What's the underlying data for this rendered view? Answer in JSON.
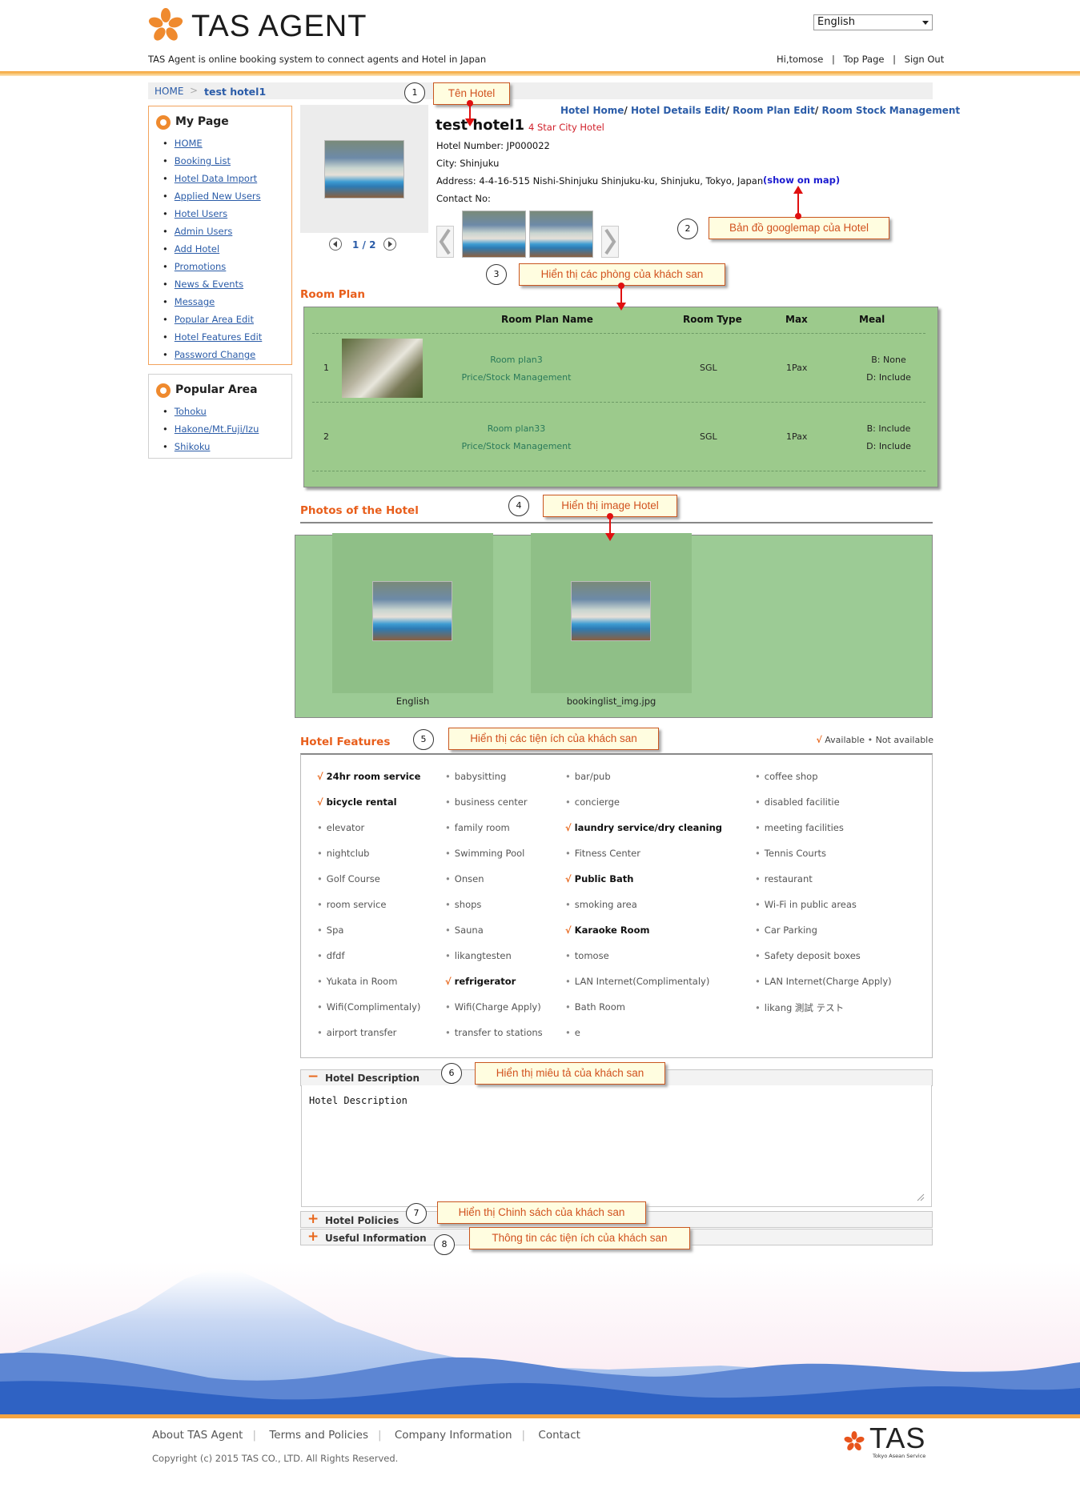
{
  "header": {
    "logo_text": "TAS AGENT",
    "tagline": "TAS Agent is online booking system to connect agents and Hotel in Japan",
    "language": "English",
    "greeting": "Hi,tomose",
    "top_page": "Top Page",
    "sign_out": "Sign Out",
    "sep": "|"
  },
  "breadcrumb": {
    "home": "HOME",
    "sep": ">",
    "current": "test hotel1"
  },
  "mypage": {
    "title": "My Page",
    "items": [
      "HOME",
      "Booking List",
      "Hotel Data Import",
      "Applied New Users",
      "Hotel Users",
      "Admin Users",
      "Add Hotel",
      "Promotions",
      "News & Events",
      "Message",
      "Popular Area Edit",
      "Hotel Features Edit",
      "Password Change"
    ]
  },
  "popular": {
    "title": "Popular Area",
    "items": [
      "Tohoku",
      "Hakone/Mt.Fuji/Izu",
      "Shikoku"
    ]
  },
  "top_links": {
    "hotel_home": "Hotel Home",
    "sep": "/",
    "details_edit": "Hotel Details Edit",
    "room_plan_edit": "Room Plan Edit",
    "room_stock": "Room Stock Management"
  },
  "hotel": {
    "name": "test hotel1",
    "stars": "4 Star City Hotel",
    "number": "Hotel Number: JP000022",
    "city": "City: Shinjuku",
    "address": "Address: 4-4-16-515 Nishi-Shinjuku Shinjuku-ku, Shinjuku, Tokyo, Japan",
    "map_link": "(show on map)",
    "contact": "Contact No:",
    "pager": "1 / 2"
  },
  "annotations": [
    {
      "num": "1",
      "text": "Tên Hotel"
    },
    {
      "num": "2",
      "text": "Bản đồ googlemap của Hotel"
    },
    {
      "num": "3",
      "text": "Hiển thị các phòng của khách san"
    },
    {
      "num": "4",
      "text": "Hiển thị image Hotel"
    },
    {
      "num": "5",
      "text": "Hiển thị các tiện ích của khách san"
    },
    {
      "num": "6",
      "text": "Hiển thị miêu tả của khách san"
    },
    {
      "num": "7",
      "text": "Hiển thị Chinh sách của khách san"
    },
    {
      "num": "8",
      "text": "Thông tin các tiện ích của khách san"
    }
  ],
  "room_plan": {
    "title": "Room Plan",
    "headers": {
      "name": "Room Plan Name",
      "type": "Room Type",
      "max": "Max",
      "meal": "Meal"
    },
    "rows": [
      {
        "no": "1",
        "name": "Room plan3",
        "link": "Price/Stock Management",
        "type": "SGL",
        "max": "1Pax",
        "meal1": "B: None",
        "meal2": "D: Include"
      },
      {
        "no": "2",
        "name": "Room plan33",
        "link": "Price/Stock Management",
        "type": "SGL",
        "max": "1Pax",
        "meal1": "B: Include",
        "meal2": "D: Include"
      }
    ]
  },
  "photos": {
    "title": "Photos of the Hotel",
    "items": [
      "English",
      "bookinglist_img.jpg"
    ]
  },
  "features": {
    "title": "Hotel Features",
    "legend_available": "Available",
    "legend_not": "Not available",
    "check": "√",
    "bullet": "•",
    "rows": [
      [
        [
          "24hr room service",
          true
        ],
        [
          "babysitting",
          false
        ],
        [
          "bar/pub",
          false
        ],
        [
          "coffee shop",
          false
        ]
      ],
      [
        [
          "bicycle rental",
          true
        ],
        [
          "business center",
          false
        ],
        [
          "concierge",
          false
        ],
        [
          "disabled facilitie",
          false
        ]
      ],
      [
        [
          "elevator",
          false
        ],
        [
          "family room",
          false
        ],
        [
          "laundry service/dry cleaning",
          true
        ],
        [
          "meeting facilities",
          false
        ]
      ],
      [
        [
          "nightclub",
          false
        ],
        [
          "Swimming Pool",
          false
        ],
        [
          "Fitness Center",
          false
        ],
        [
          "Tennis Courts",
          false
        ]
      ],
      [
        [
          "Golf Course",
          false
        ],
        [
          "Onsen",
          false
        ],
        [
          "Public Bath",
          true
        ],
        [
          "restaurant",
          false
        ]
      ],
      [
        [
          "room service",
          false
        ],
        [
          "shops",
          false
        ],
        [
          "smoking area",
          false
        ],
        [
          "Wi-Fi in public areas",
          false
        ]
      ],
      [
        [
          "Spa",
          false
        ],
        [
          "Sauna",
          false
        ],
        [
          "Karaoke Room",
          true
        ],
        [
          "Car Parking",
          false
        ]
      ],
      [
        [
          "dfdf",
          false
        ],
        [
          "likangtesten",
          false
        ],
        [
          "tomose",
          false
        ],
        [
          "Safety deposit boxes",
          false
        ]
      ],
      [
        [
          "Yukata in Room",
          false
        ],
        [
          "refrigerator",
          true
        ],
        [
          "LAN Internet(Complimentaly)",
          false
        ],
        [
          "LAN Internet(Charge Apply)",
          false
        ]
      ],
      [
        [
          "Wifi(Complimentaly)",
          false
        ],
        [
          "Wifi(Charge Apply)",
          false
        ],
        [
          "Bath Room",
          false
        ],
        [
          "likang 測試 テスト",
          false
        ]
      ],
      [
        [
          "airport transfer",
          false
        ],
        [
          "transfer to stations",
          false
        ],
        [
          "e",
          false
        ]
      ]
    ]
  },
  "description": {
    "title": "Hotel Description",
    "text": "Hotel Description",
    "minus": "−"
  },
  "policies": {
    "title": "Hotel Policies",
    "plus": "+"
  },
  "useful": {
    "title": "Useful Information",
    "plus": "+"
  },
  "footer": {
    "links": [
      "About TAS Agent",
      "Terms and Policies",
      "Company Information",
      "Contact"
    ],
    "sep": "|",
    "copyright": "Copyright (c) 2015 TAS CO., LTD. All Rights Reserved.",
    "brand": "TAS",
    "brand_sub": "Tokyo Asean Service"
  }
}
